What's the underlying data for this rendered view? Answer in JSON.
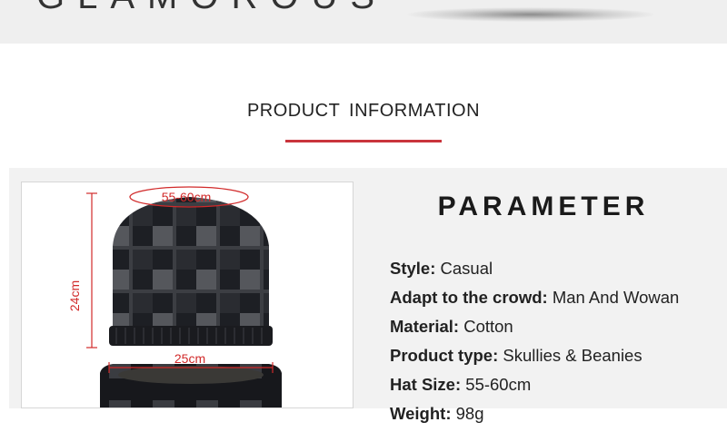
{
  "brand": {
    "text": "GLAMOROUS"
  },
  "section": {
    "title": "PRODUCT INFORMATION"
  },
  "colors": {
    "accent": "#c9343c",
    "panel_bg": "#f2f2f2",
    "dimension_red": "#d12a2a"
  },
  "product_image": {
    "circumference_label": "55-60cm",
    "height_label": "24cm",
    "width_label": "25cm"
  },
  "parameters": {
    "title": "PARAMETER",
    "items": [
      {
        "key": "Style:",
        "value": "Casual"
      },
      {
        "key": "Adapt to the crowd:",
        "value": "Man And Wowan"
      },
      {
        "key": "Material:",
        "value": "Cotton"
      },
      {
        "key": "Product type:",
        "value": "Skullies & Beanies"
      },
      {
        "key": "Hat Size:",
        "value": "55-60cm"
      },
      {
        "key": "Weight:",
        "value": "98g"
      }
    ]
  }
}
